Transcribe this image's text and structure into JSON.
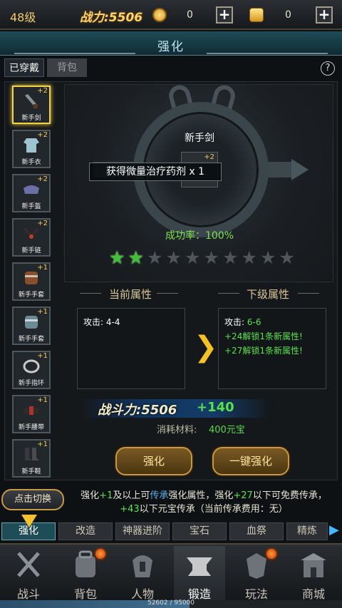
{
  "top": {
    "level": "48级",
    "power": "战力:5506",
    "currency1": "0",
    "currency2": "0"
  },
  "title": "强化",
  "tabs": {
    "worn": "已穿戴",
    "bag": "背包"
  },
  "items": [
    {
      "name": "新手剑",
      "plus": "+2"
    },
    {
      "name": "新手衣",
      "plus": "+2"
    },
    {
      "name": "新手盔",
      "plus": "+2"
    },
    {
      "name": "新手链",
      "plus": "+2"
    },
    {
      "name": "新手手套",
      "plus": "+1"
    },
    {
      "name": "新手手套",
      "plus": "+1"
    },
    {
      "name": "新手指环",
      "plus": "+1"
    },
    {
      "name": "新手腰带",
      "plus": "+1"
    },
    {
      "name": "新手鞋",
      "plus": "+1"
    }
  ],
  "forge": {
    "weapon_name": "新手剑",
    "weapon_plus": "+2",
    "toast": "获得微量治疗药剂 x 1",
    "success_rate": "成功率：100%",
    "stars_total": 10,
    "stars_filled": 2
  },
  "attrs": {
    "current_title": "当前属性",
    "next_title": "下级属性",
    "current_label": "攻击:",
    "current_value": "4-4",
    "next_label": "攻击:",
    "next_value": "6-6",
    "next_bonus1": "+24解锁1条新属性!",
    "next_bonus2": "+27解锁1条新属性!"
  },
  "power_mid": "战斗力:5506",
  "power_add": "+140",
  "cost_label": "消耗材料:",
  "cost_value": "400元宝",
  "buttons": {
    "strengthen": "强化",
    "onekey": "一键强化"
  },
  "hint": {
    "p1": "强化",
    "p2": "+1",
    "p3": "及以上可",
    "p4": "传承",
    "p5": "强化属性，强化",
    "p6": "+27",
    "p7": "以下可免费传承，",
    "p8": "+43",
    "p9": "以下元宝传承（当前传承费用：无）"
  },
  "switch": "点击切换",
  "subtabs": [
    "强化",
    "改造",
    "神器进阶",
    "宝石",
    "血祭",
    "精炼"
  ],
  "nav": [
    {
      "label": "战斗",
      "badge": false
    },
    {
      "label": "背包",
      "badge": true
    },
    {
      "label": "人物",
      "badge": false
    },
    {
      "label": "锻造",
      "badge": false
    },
    {
      "label": "玩法",
      "badge": true
    },
    {
      "label": "商城",
      "badge": false
    }
  ],
  "xp": {
    "text": "52602 / 95000",
    "fraction": 0.554
  },
  "colors": {
    "accent_gold": "#f2d541",
    "green": "#58e14a",
    "teal": "#1e4c57"
  }
}
